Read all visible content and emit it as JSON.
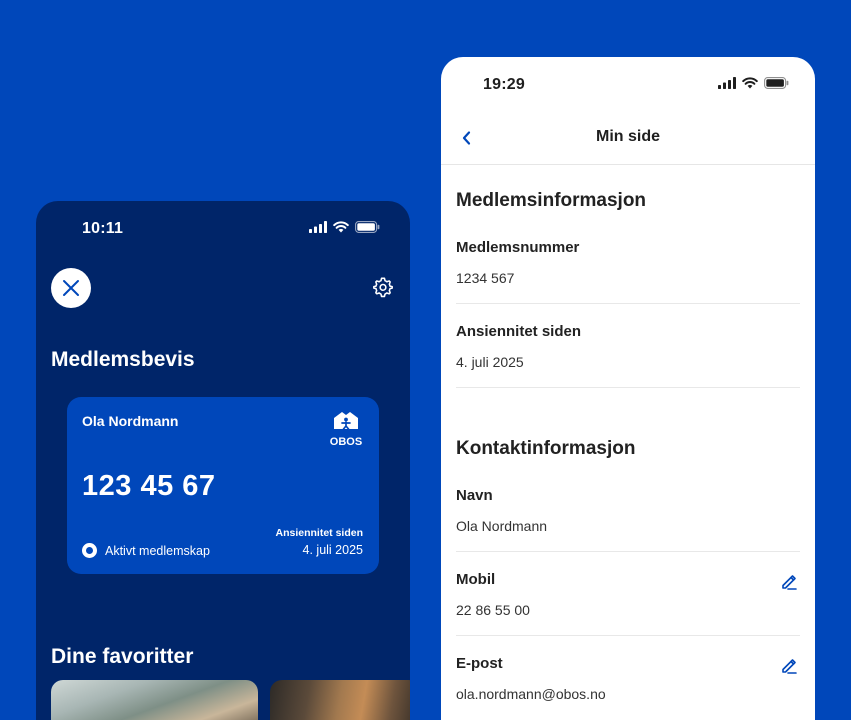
{
  "left_screen": {
    "status_time": "10:11",
    "title": "Medlemsbevis",
    "card": {
      "holder_name": "Ola Nordmann",
      "brand": "OBOS",
      "member_number": "123 45 67",
      "status_label": "Aktivt medlemskap",
      "seniority_label": "Ansiennitet siden",
      "seniority_value": "4. juli 2025"
    },
    "favorites_title": "Dine favoritter"
  },
  "right_screen": {
    "status_time": "19:29",
    "nav_title": "Min side",
    "member_section": {
      "title": "Medlemsinformasjon",
      "fields": [
        {
          "label": "Medlemsnummer",
          "value": "1234 567"
        },
        {
          "label": "Ansiennitet siden",
          "value": "4. juli 2025"
        }
      ]
    },
    "contact_section": {
      "title": "Kontaktinformasjon",
      "fields": [
        {
          "label": "Navn",
          "value": "Ola Nordmann"
        },
        {
          "label": "Mobil",
          "value": "22 86 55 00"
        },
        {
          "label": "E-post",
          "value": "ola.nordmann@obos.no"
        }
      ]
    }
  },
  "icons": {
    "close": "close-icon",
    "settings": "gear-icon",
    "back": "chevron-left-icon",
    "edit": "pencil-icon",
    "signal": "cellular-signal-icon",
    "wifi": "wifi-icon",
    "battery": "battery-icon"
  },
  "colors": {
    "background": "#0047BA",
    "dark_panel": "#002569",
    "card": "#0047BA",
    "accent_blue": "#0047BA",
    "white": "#FFFFFF"
  }
}
